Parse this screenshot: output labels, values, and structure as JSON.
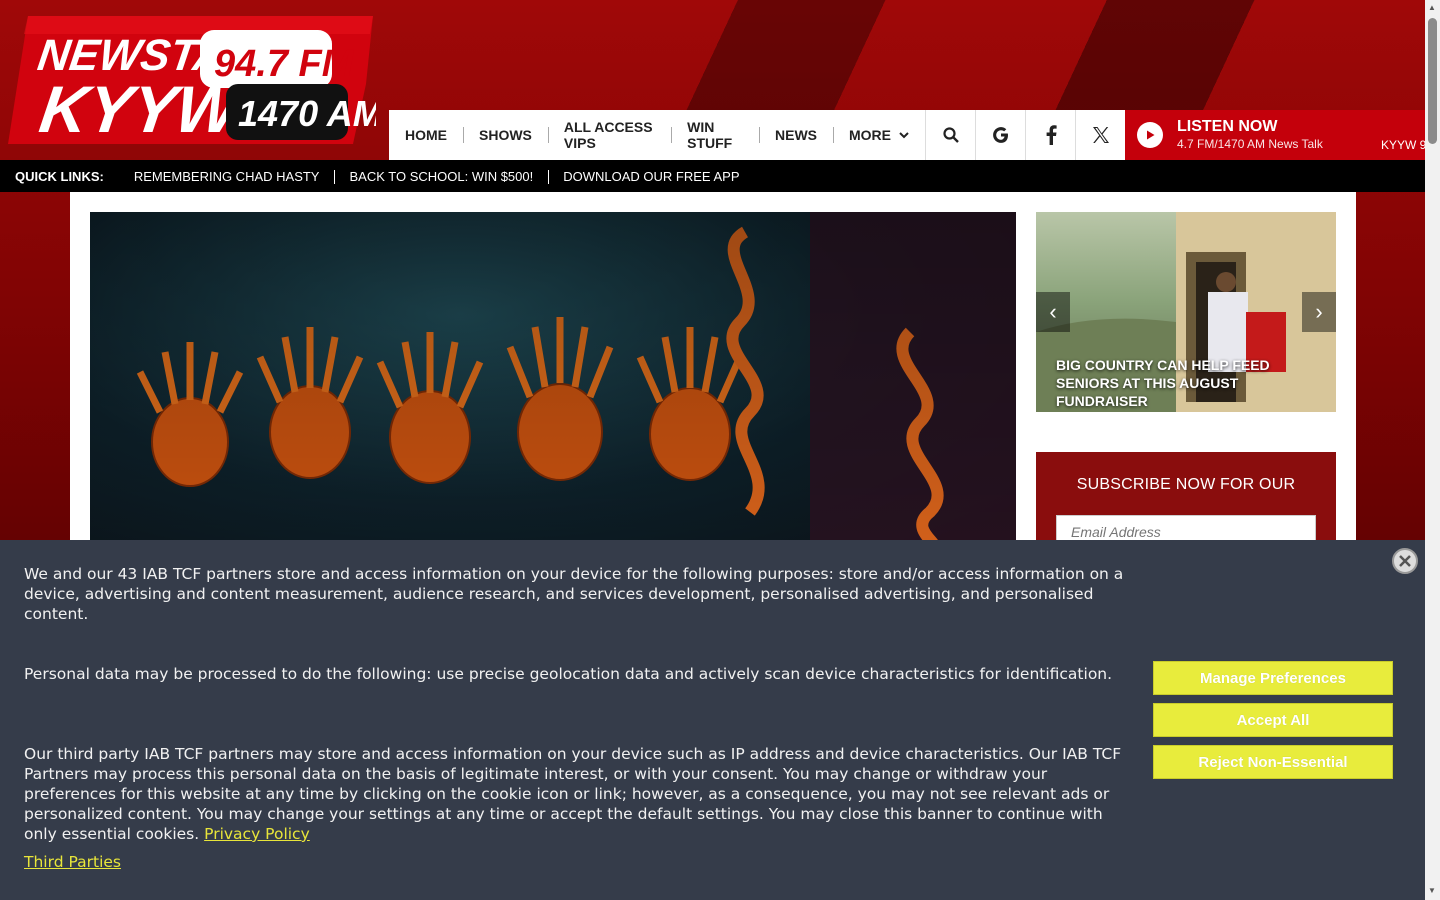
{
  "logo": {
    "line1": "NEWSTALK",
    "line2": "KYYW",
    "fm": "94.7 FM",
    "am": "1470 AM"
  },
  "nav": {
    "items": [
      {
        "label": "HOME"
      },
      {
        "label": "SHOWS"
      },
      {
        "label": "ALL ACCESS VIPS"
      },
      {
        "label": "WIN STUFF"
      },
      {
        "label": "NEWS"
      },
      {
        "label": "MORE"
      }
    ],
    "icons": [
      "search-icon",
      "google-icon",
      "facebook-icon",
      "x-twitter-icon"
    ]
  },
  "listen": {
    "title": "LISTEN NOW",
    "subtitle": "4.7 FM/1470 AM News Talk",
    "ticker": "KYYW 9"
  },
  "quicklinks": {
    "label": "QUICK LINKS:",
    "items": [
      {
        "label": "REMEMBERING CHAD HASTY"
      },
      {
        "label": "BACK TO SCHOOL: WIN $500!"
      },
      {
        "label": "DOWNLOAD OUR FREE APP"
      }
    ]
  },
  "promo": {
    "title": "BIG COUNTRY CAN HELP FEED SENIORS AT THIS AUGUST FUNDRAISER"
  },
  "subscribe": {
    "title": "SUBSCRIBE NOW FOR OUR",
    "email_placeholder": "Email Address"
  },
  "cookie": {
    "p1": "We and our 43 IAB TCF partners store and access information on your device for the following purposes: store and/or access information on a device, advertising and content measurement, audience research, and services development, personalised advertising, and personalised content.",
    "p2": "Personal data may be processed to do the following: use precise geolocation data and actively scan device characteristics for identification.",
    "p3": "Our third party IAB TCF partners may store and access information on your device such as IP address and device characteristics. Our IAB TCF Partners may process this personal data on the basis of legitimate interest, or with your consent. You may change or withdraw your preferences for this website at any time by clicking on the cookie icon or link; however, as a consequence, you may not see relevant ads or personalized content. You may change your settings at any time or accept the default settings. You may close this banner to continue with only essential cookies.",
    "privacy_link": "Privacy Policy",
    "third_parties_link": "Third Parties",
    "manage_label": "Manage Preferences",
    "accept_label": "Accept All",
    "reject_label": "Reject Non-Essential"
  },
  "colors": {
    "brand_red": "#c4000b",
    "cookie_bg": "#353c4a",
    "cookie_button": "#e8ec3c",
    "subscribe_bg": "#8a0d0d"
  }
}
